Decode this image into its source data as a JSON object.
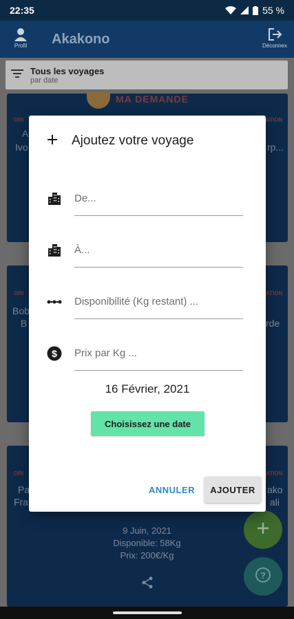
{
  "status_bar": {
    "time": "22:35",
    "battery": "55 %"
  },
  "app_bar": {
    "title": "Akakono",
    "profile_label": "Profil",
    "logout_label": "Déconnex"
  },
  "filter": {
    "title": "Tous les voyages",
    "subtitle": "par date"
  },
  "background": {
    "banner": "MA DEMANDE",
    "card1": {
      "origin_tag": "ORI",
      "right_tag": "ATION",
      "line1": "A",
      "line2": "Ivo",
      "right_line2": "rp..."
    },
    "card2": {
      "origin_tag": "ORI",
      "right_tag": "ATION",
      "line1": "Bob",
      "line2": "B",
      "right_line2": "rde"
    },
    "card3": {
      "origin_tag": "ORI",
      "right_tag": "ATION",
      "line1": "Pa",
      "line2": "Fra",
      "right_line1": "ako",
      "right_line2": "ali",
      "date": "9 Juin, 2021",
      "available": "Disponible: 58Kg",
      "price": "Prix: 200€/Kg"
    }
  },
  "dialog": {
    "title": "Ajoutez votre voyage",
    "fields": {
      "from_placeholder": "De...",
      "to_placeholder": "À...",
      "capacity_placeholder": "Disponibilité (Kg restant) ...",
      "price_placeholder": "Prix par Kg ..."
    },
    "date": "16 Février, 2021",
    "pick_date_label": "Choisissez une date",
    "cancel_label": "ANNULER",
    "add_label": "AJOUTER"
  },
  "colors": {
    "accent_green": "#64e3a8",
    "link_blue": "#2f88c8",
    "app_bar": "#113a66"
  }
}
